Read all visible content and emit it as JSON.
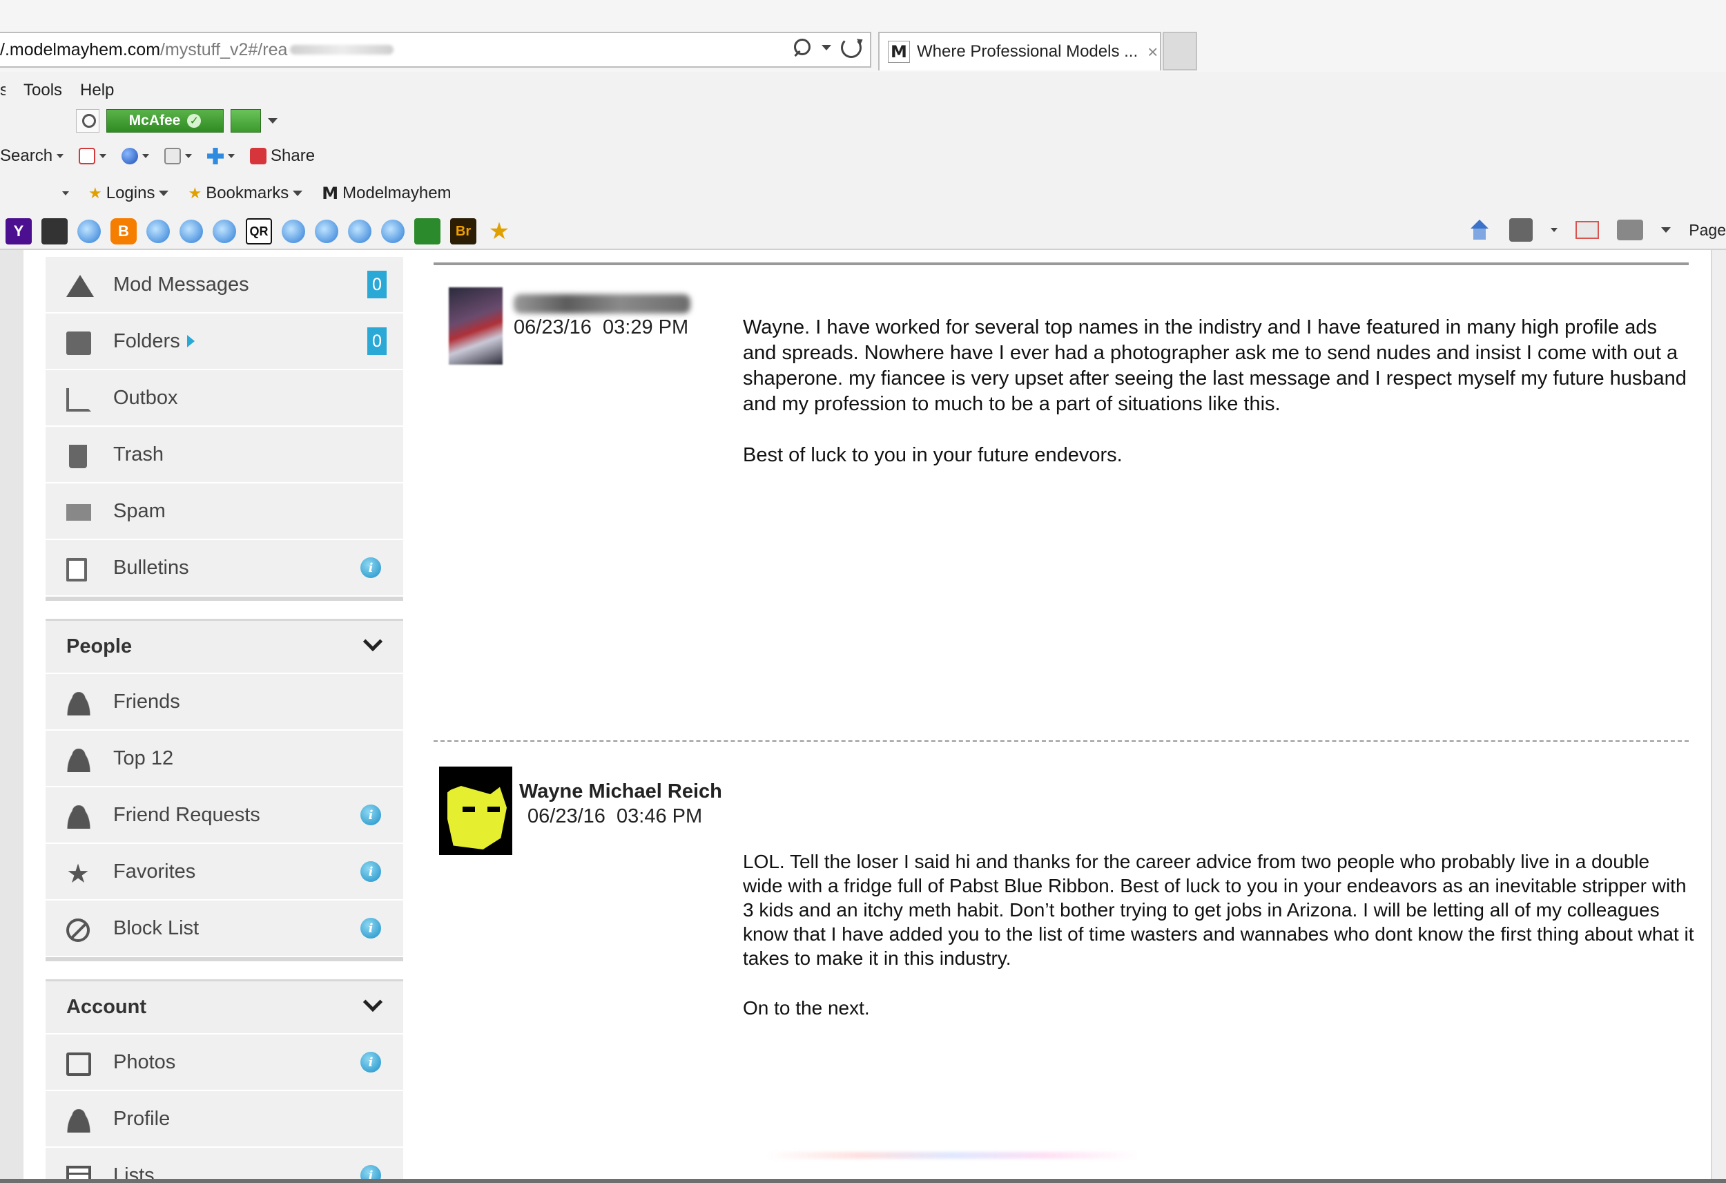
{
  "browser": {
    "url_host": "/.modelmayhem.com",
    "url_path": "/mystuff_v2#/rea",
    "tab_title": "Where Professional Models ...",
    "tab_favicon": "M",
    "tab_close": "×"
  },
  "menu": {
    "items": [
      "s",
      "Tools",
      "Help"
    ]
  },
  "addons": {
    "mcafee_label": "McAfee",
    "mcafee_check": "✓"
  },
  "search_toolbar": {
    "search_label": "Search",
    "share_label": "Share"
  },
  "favorites_bar": {
    "logins": "Logins",
    "bookmarks": "Bookmarks",
    "modelmayhem": "Modelmayhem",
    "mm_glyph": "M"
  },
  "command_bar": {
    "page_label": "Page"
  },
  "quick_icons": [
    "Y",
    "ie",
    "B",
    "ie",
    "ie",
    "ie",
    "QR",
    "ie",
    "ie",
    "ie",
    "ie",
    "green",
    "Br",
    "★"
  ],
  "sidebar": {
    "mod_messages": {
      "label": "Mod Messages",
      "count": "0"
    },
    "folders": {
      "label": "Folders",
      "count": "0"
    },
    "outbox": {
      "label": "Outbox"
    },
    "trash": {
      "label": "Trash"
    },
    "spam": {
      "label": "Spam"
    },
    "bulletins": {
      "label": "Bulletins",
      "info": "i"
    },
    "people_section": "People",
    "friends": {
      "label": "Friends"
    },
    "top12": {
      "label": "Top 12"
    },
    "friend_requests": {
      "label": "Friend Requests",
      "info": "i"
    },
    "favorites": {
      "label": "Favorites",
      "info": "i",
      "icon": "★"
    },
    "block_list": {
      "label": "Block List",
      "info": "i"
    },
    "account_section": "Account",
    "photos": {
      "label": "Photos",
      "info": "i"
    },
    "profile": {
      "label": "Profile"
    },
    "lists": {
      "label": "Lists",
      "info": "i"
    }
  },
  "messages": [
    {
      "sender": "",
      "date": "06/23/16  03:29 PM",
      "body": [
        "Wayne. I have worked for several top names in the indistry and I have featured in many high profile ads and spreads. Nowhere have I ever had a photographer ask me to send nudes and insist I come with out a shaperone. my fiancee is very upset after seeing the last message and I respect myself my future husband and my profession to much to be a part of situations like this.",
        "Best of luck to you in your future endevors."
      ]
    },
    {
      "sender": "Wayne Michael Reich",
      "date": "06/23/16  03:46 PM",
      "body": [
        "LOL. Tell the loser I said hi and thanks for the career advice from two people who probably live in a double wide with a fridge full of Pabst Blue Ribbon. Best of luck to you in your endeavors as an inevitable stripper with 3 kids and an itchy meth habit. Don’t bother trying to get jobs in Arizona. I will be letting all of my colleagues know that I have added you to the list of time wasters and wannabes who dont know the first thing about what it takes to make it in this industry.",
        "On to the next."
      ]
    }
  ]
}
